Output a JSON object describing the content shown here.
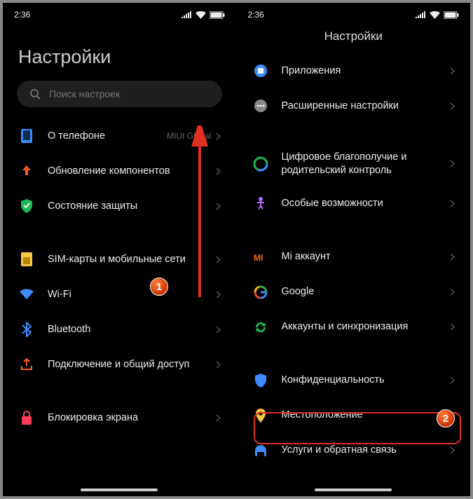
{
  "status": {
    "time": "2:36"
  },
  "left": {
    "title": "Настройки",
    "search_placeholder": "Поиск настроек",
    "items": [
      {
        "label": "О телефоне",
        "sub": "MIUI Global"
      },
      {
        "label": "Обновление компонентов"
      },
      {
        "label": "Состояние защиты"
      }
    ],
    "items2": [
      {
        "label": "SIM-карты и мобильные сети"
      },
      {
        "label": "Wi-Fi"
      },
      {
        "label": "Bluetooth"
      },
      {
        "label": "Подключение и общий доступ"
      }
    ],
    "items3": [
      {
        "label": "Блокировка экрана"
      }
    ]
  },
  "right": {
    "title": "Настройки",
    "items": [
      {
        "label": "Приложения"
      },
      {
        "label": "Расширенные настройки"
      }
    ],
    "items2": [
      {
        "label": "Цифровое благополучие и родительский контроль"
      },
      {
        "label": "Особые возможности"
      }
    ],
    "items3": [
      {
        "label": "Mi аккаунт"
      },
      {
        "label": "Google"
      },
      {
        "label": "Аккаунты и синхронизация"
      }
    ],
    "items4": [
      {
        "label": "Конфиденциальность"
      },
      {
        "label": "Местоположение"
      },
      {
        "label": "Услуги и обратная связь"
      }
    ]
  },
  "markers": {
    "m1": "1",
    "m2": "2"
  },
  "colors": {
    "highlight": "#e03020",
    "marker_bg": "#ff5a1f"
  }
}
